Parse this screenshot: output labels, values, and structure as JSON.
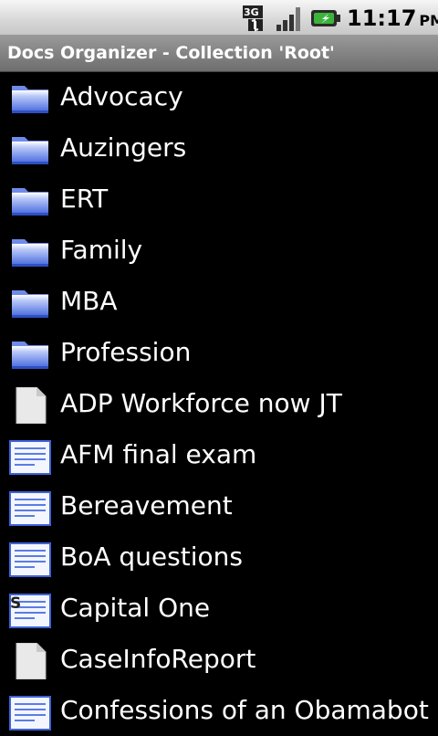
{
  "status_bar": {
    "network_type": "3G",
    "time": "11:17",
    "ampm": "PM",
    "icons": [
      "3g-data-icon",
      "signal-strength-icon",
      "battery-charging-icon"
    ]
  },
  "title_bar": {
    "title": "Docs Organizer - Collection 'Root'"
  },
  "items": [
    {
      "label": "Advocacy",
      "icon": "folder-icon"
    },
    {
      "label": "Auzingers",
      "icon": "folder-icon"
    },
    {
      "label": "ERT",
      "icon": "folder-icon"
    },
    {
      "label": "Family",
      "icon": "folder-icon"
    },
    {
      "label": "MBA",
      "icon": "folder-icon"
    },
    {
      "label": "Profession",
      "icon": "folder-icon"
    },
    {
      "label": "ADP Workforce now JT",
      "icon": "blank-file-icon"
    },
    {
      "label": "AFM final exam",
      "icon": "document-icon"
    },
    {
      "label": "Bereavement",
      "icon": "document-icon"
    },
    {
      "label": "BoA questions",
      "icon": "document-icon"
    },
    {
      "label": "Capital One",
      "icon": "spreadsheet-document-icon"
    },
    {
      "label": "CaseInfoReport",
      "icon": "blank-file-icon"
    },
    {
      "label": "Confessions of an Obamabot",
      "icon": "document-icon"
    }
  ],
  "colors": {
    "background": "#000000",
    "folder_blue": "#4a6fe0",
    "doc_blue": "#3d62d8"
  }
}
